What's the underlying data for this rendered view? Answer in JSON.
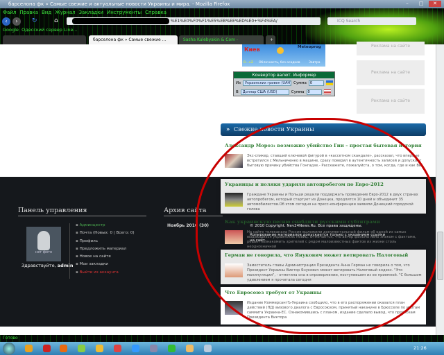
{
  "browser": {
    "title": "барселона фк » Самые свежие и актуальные новости Украины и мира. - Mozilla Firefox",
    "menu": [
      "Файл",
      "Правка",
      "Вид",
      "Журнал",
      "Закладки",
      "Инструменты",
      "Справка"
    ],
    "url": "%E1%E0%F0%F1%E5%EB%EE%ED%E0+%F4%EA/",
    "search_placeholder": "ICQ Search",
    "bookmarks": [
      "Google",
      "Одесский сервер Line..."
    ],
    "tabs": [
      "барселона фк » Самые свежие ...",
      "Sasha Kulebyakin & Com - Онлайн..."
    ],
    "status": "Готово"
  },
  "weather": {
    "city": "Киев",
    "brand": "Meteoprog",
    "temp": "0...+2",
    "desc": "Облачность, без осадков",
    "day": "Завтра"
  },
  "converter": {
    "title": "Конвертор валют. Информер",
    "from_label": "Из",
    "to_label": "В",
    "from": "Украинских гривен (UAH)",
    "to": "Доллар США (USD)",
    "sum_label": "Сумма",
    "sum1": "0",
    "sum2": "0"
  },
  "ads": [
    "Реклама на сайте",
    "Реклама на сайте",
    "Реклама на сайте",
    "Реклама на сайте"
  ],
  "news": {
    "header": "Свежие новости Украины",
    "items": [
      {
        "title": "Александр Мороз: возможно убийство Гии – простая бытовая история",
        "text": "Экс-спикер, ставший ключевой фигурой в «кассетном скандале», рассказал, что впервые встретился с Мельниченко в машине, сразу поверил в аутентичность записей и допускает бытовую причину убийства Гонгадзе.- Расскажите, пожалуйста, о том, когда, где и как Вы"
      },
      {
        "title": "Украинцы и поляки ударили автопробегом по Евро-2012",
        "text": "Граждане Украины и Польши решили поддержать проведение Евро-2012 в двух странах автопробегом, который стартует из Донецка, продлится 10 дней и объединит 35 автомобилистов.Об этом сегодня на пресс-конференции заявили Донецкий городской голова"
      },
      {
        "title": "Как украинскую песню снабдили русскими субтитрами",
        "text": "На сайте телеканала Россия выложили документальный фильм об одной из самых выдающихся украинских певиц. Отмечается, что автор фильма явно знаком с фактами, решил познакомить зрителей с рядом малоизвестных фактов из жизни столь неоднозначной"
      },
      {
        "title": "Герман не говорила, что Янукович может ветировать Налоговый",
        "text": "Заместитель главы Администрации Президента Анна Герман не говорила о том, что Президент Украины Виктор Янукович может ветировать Налоговый кодекс. \"Это манипуляции\", - отметила она в опровержении, поступившем из ее приемной. \"С большим удивлением я прочитала сегодня"
      },
      {
        "title": "Что Евросоюз требует от Украины",
        "text": "Издание КоммерсантЪ-Украина сообщило, что в его распоряжении оказался план действий (ПД) визового диалога с Евросоюзом, принятый накануне в Брюсселе по итогам саммита Украина-ЕС. Ознакомившись с планом, издание сделало вывод, что прогнозам Президента Виктора"
      }
    ]
  },
  "panel": {
    "title": "Панель управления",
    "photo": "нет фото",
    "greeting": "Здравствуйте,",
    "user": "admin",
    "menu": [
      "Админцентр",
      "Почта (Новых: 0 | Всего: 0)",
      "Профиль",
      "Предложить материал",
      "Новое на сайте",
      "Мои закладки",
      "Выйти из аккаунта"
    ]
  },
  "archive": {
    "title": "Архив сайта",
    "item": "Ноябрь 2010 (30)"
  },
  "copyright": {
    "line1": "© 2010 Copyright. Nev24News.Ru. Все права защищены.",
    "line2": "Копирование материалов допускается только с указанием ссылки на сайт."
  },
  "clock": "21:26"
}
